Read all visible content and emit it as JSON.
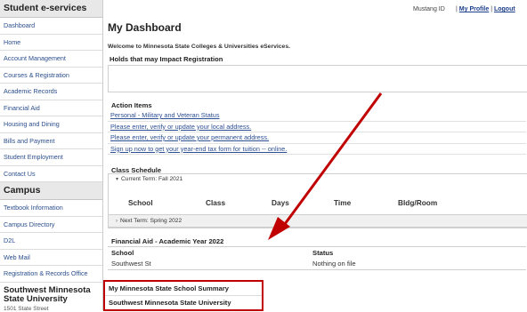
{
  "sidebar": {
    "header": "Student e-services",
    "items": [
      "Dashboard",
      "Home",
      "Account Management",
      "Courses & Registration",
      "Academic Records",
      "Financial Aid",
      "Housing and Dining",
      "Bills and Payment",
      "Student Employment",
      "Contact Us"
    ],
    "campus_header": "Campus",
    "campus_items": [
      "Textbook Information",
      "Campus Directory",
      "D2L",
      "Web Mail",
      "Registration & Records Office"
    ],
    "university": "Southwest Minnesota State University",
    "address": "1501 State Street"
  },
  "header": {
    "title": "My Dashboard",
    "mustang_id": "Mustang ID",
    "profile_link": "My Profile",
    "logout_link": "Logout",
    "separator": "|",
    "welcome": "Welcome to Minnesota State Colleges & Universities eServices."
  },
  "holds": {
    "title": "Holds that may Impact Registration"
  },
  "action_items": {
    "title": "Action Items",
    "links": [
      "Personal - Military and Veteran Status",
      "Please enter, verify or update your local address.",
      "Please enter, verify or update your permanent address.",
      "Sign up now to get your year-end tax form for tuition -- online."
    ]
  },
  "class_schedule": {
    "title": "Class Schedule",
    "current_term": "Current Term: Fall 2021",
    "columns": [
      "School",
      "Class",
      "Days",
      "Time",
      "Bldg/Room"
    ],
    "next_term": "Next Term: Spring 2022"
  },
  "financial_aid": {
    "title": "Financial Aid - Academic Year 2022",
    "school_header": "School",
    "status_header": "Status",
    "school_value": "Southwest St",
    "status_value": "Nothing on file"
  },
  "summary": {
    "title": "My Minnesota State School Summary",
    "school": "Southwest Minnesota State University"
  },
  "annotation": {
    "arrow_color": "#c00000"
  }
}
